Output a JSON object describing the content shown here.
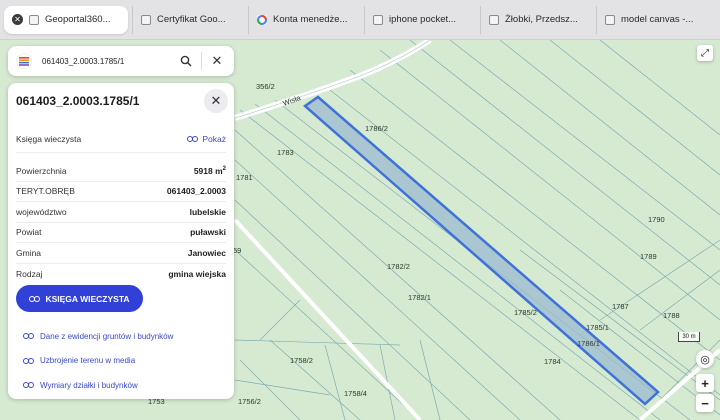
{
  "tabs": [
    {
      "label": "Geoportal360...",
      "active": true
    },
    {
      "label": "Certyfikat Goo...",
      "active": false
    },
    {
      "label": "Konta menedże...",
      "active": false
    },
    {
      "label": "iphone pocket...",
      "active": false
    },
    {
      "label": "Żłobki, Przedsz...",
      "active": false
    },
    {
      "label": "model canvas -...",
      "active": false
    }
  ],
  "search": {
    "value": "061403_2.0003.1785/1"
  },
  "panel": {
    "title": "061403_2.0003.1785/1",
    "rows": {
      "ksiega_label": "Księga wieczysta",
      "ksiega_link": "Pokaż",
      "powierzchnia_label": "Powierzchnia",
      "powierzchnia_value": "5918 m",
      "powierzchnia_unit_sup": "2",
      "teryt_label": "TERYT.OBRĘB",
      "teryt_value": "061403_2.0003",
      "woj_label": "województwo",
      "woj_value": "lubelskie",
      "powiat_label": "Powiat",
      "powiat_value": "puławski",
      "gmina_label": "Gmina",
      "gmina_value": "Janowiec",
      "rodzaj_label": "Rodzaj",
      "rodzaj_value": "gmina wiejska"
    },
    "button": "KSIĘGA WIECZYSTA",
    "links": [
      "Dane z ewidencji gruntów i budynków",
      "Uzbrojenie terenu w media",
      "Wymiary działki i budynków"
    ]
  },
  "map": {
    "parcel_labels": [
      "356/2",
      "1786/2",
      "1783",
      "1781",
      "59",
      "1782/2",
      "1782/1",
      "1785/2",
      "1784",
      "1785/1",
      "1786/1",
      "1787",
      "1788",
      "1789",
      "1790",
      "1758/2",
      "1758/4",
      "1756/2",
      "1753"
    ],
    "road_label": "Wisła",
    "scale": "30 m",
    "highlight_color": "#3f72d9"
  }
}
